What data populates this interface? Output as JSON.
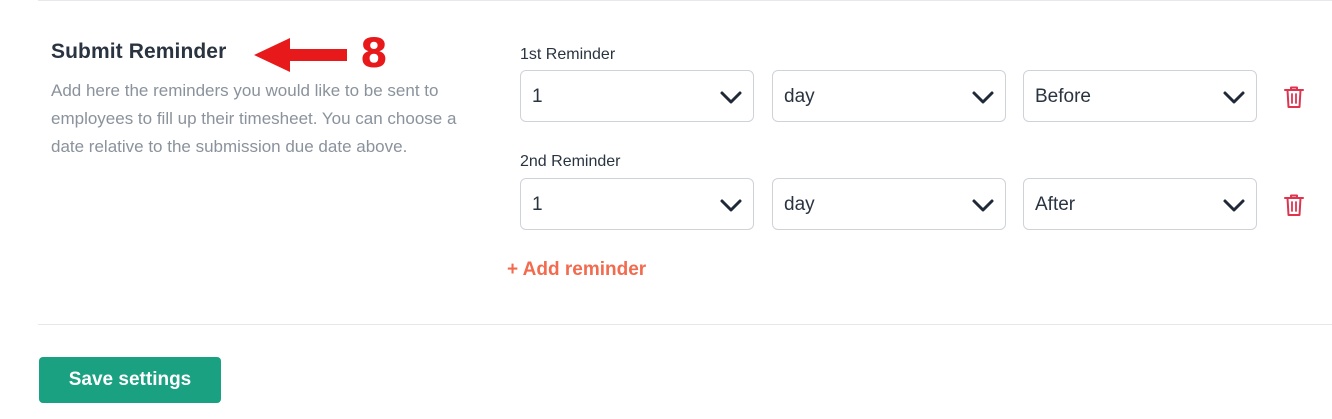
{
  "section": {
    "title": "Submit Reminder",
    "description": "Add here the reminders you would like to be sent to employees to fill up their timesheet. You can choose a date relative to the submission due date above.",
    "annotation_number": "8"
  },
  "reminders": [
    {
      "label": "1st Reminder",
      "amount": "1",
      "unit": "day",
      "relation": "Before"
    },
    {
      "label": "2nd Reminder",
      "amount": "1",
      "unit": "day",
      "relation": "After"
    }
  ],
  "add_reminder_label": "+ Add reminder",
  "save_button_label": "Save settings",
  "colors": {
    "accent_orange": "#f26b4f",
    "save_green": "#1aa181",
    "delete_red": "#e0334e",
    "annotation_red": "#e8191b"
  },
  "icons": {
    "chevron": "chevron-down-icon",
    "delete": "trash-icon",
    "annotation": "arrow-left-icon"
  }
}
